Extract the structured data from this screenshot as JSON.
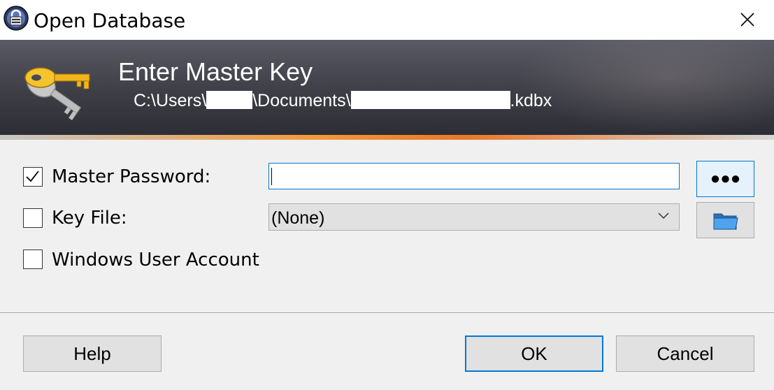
{
  "window": {
    "title": "Open Database",
    "icon": "keepass-lock-icon"
  },
  "banner": {
    "title": "Enter Master Key",
    "path_prefix": "C:\\Users\\",
    "path_middle": "\\Documents\\",
    "path_suffix": ".kdbx",
    "icon": "key-icon"
  },
  "form": {
    "master_password": {
      "label": "Master Password:",
      "checked": true,
      "value": "",
      "toggle_button_label": "●●●"
    },
    "key_file": {
      "label": "Key File:",
      "checked": false,
      "selected": "(None)",
      "browse_icon": "folder-icon"
    },
    "windows_user_account": {
      "label": "Windows User Account",
      "checked": false
    }
  },
  "buttons": {
    "help": "Help",
    "ok": "OK",
    "cancel": "Cancel"
  },
  "colors": {
    "accent": "#0078d7",
    "banner_dark": "#3e3e47",
    "banner_orange": "#f29a3c"
  }
}
